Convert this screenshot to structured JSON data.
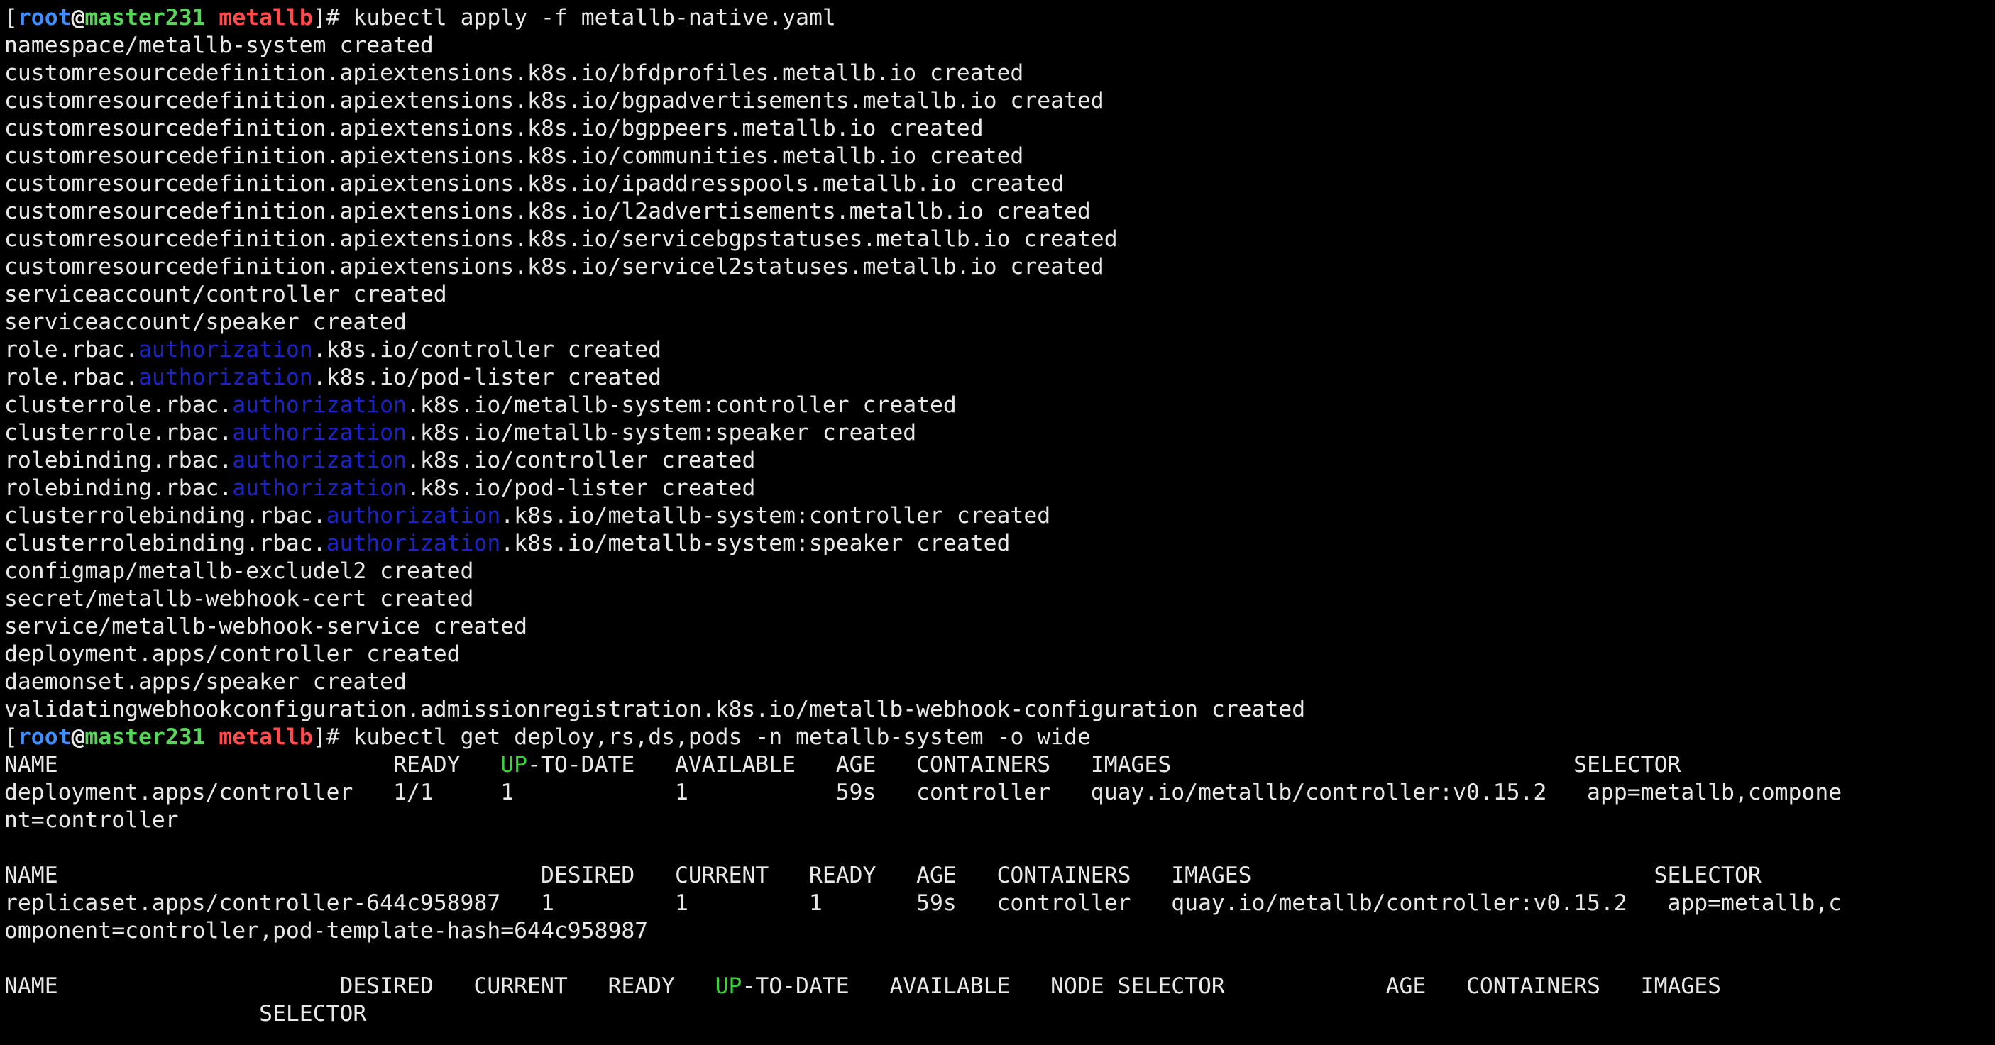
{
  "colors": {
    "background": "#000000",
    "foreground": "#e8e8e8",
    "prompt_user": "#3f8fff",
    "prompt_host": "#58d65a",
    "prompt_dir": "#ff4d4d",
    "highlight_blue": "#1a24c8",
    "highlight_green": "#3ad23a"
  },
  "lines": [
    [
      {
        "t": "[",
        "c": "b"
      },
      {
        "t": "root",
        "c": "user"
      },
      {
        "t": "@",
        "c": "at"
      },
      {
        "t": "master231",
        "c": "host"
      },
      {
        "t": " ",
        "c": "b"
      },
      {
        "t": "metallb",
        "c": "dir"
      },
      {
        "t": "]# kubectl apply -f metallb-native.yaml",
        "c": "b"
      }
    ],
    [
      {
        "t": "namespace/metallb-system created",
        "c": "b"
      }
    ],
    [
      {
        "t": "customresourcedefinition.apiextensions.k8s.io/bfdprofiles.metallb.io created",
        "c": "b"
      }
    ],
    [
      {
        "t": "customresourcedefinition.apiextensions.k8s.io/bgpadvertisements.metallb.io created",
        "c": "b"
      }
    ],
    [
      {
        "t": "customresourcedefinition.apiextensions.k8s.io/bgppeers.metallb.io created",
        "c": "b"
      }
    ],
    [
      {
        "t": "customresourcedefinition.apiextensions.k8s.io/communities.metallb.io created",
        "c": "b"
      }
    ],
    [
      {
        "t": "customresourcedefinition.apiextensions.k8s.io/ipaddresspools.metallb.io created",
        "c": "b"
      }
    ],
    [
      {
        "t": "customresourcedefinition.apiextensions.k8s.io/l2advertisements.metallb.io created",
        "c": "b"
      }
    ],
    [
      {
        "t": "customresourcedefinition.apiextensions.k8s.io/servicebgpstatuses.metallb.io created",
        "c": "b"
      }
    ],
    [
      {
        "t": "customresourcedefinition.apiextensions.k8s.io/servicel2statuses.metallb.io created",
        "c": "b"
      }
    ],
    [
      {
        "t": "serviceaccount/controller created",
        "c": "b"
      }
    ],
    [
      {
        "t": "serviceaccount/speaker created",
        "c": "b"
      }
    ],
    [
      {
        "t": "role.rbac.",
        "c": "b"
      },
      {
        "t": "authorization",
        "c": "blue"
      },
      {
        "t": ".k8s.io/controller created",
        "c": "b"
      }
    ],
    [
      {
        "t": "role.rbac.",
        "c": "b"
      },
      {
        "t": "authorization",
        "c": "blue"
      },
      {
        "t": ".k8s.io/pod-lister created",
        "c": "b"
      }
    ],
    [
      {
        "t": "clusterrole.rbac.",
        "c": "b"
      },
      {
        "t": "authorization",
        "c": "blue"
      },
      {
        "t": ".k8s.io/metallb-system:controller created",
        "c": "b"
      }
    ],
    [
      {
        "t": "clusterrole.rbac.",
        "c": "b"
      },
      {
        "t": "authorization",
        "c": "blue"
      },
      {
        "t": ".k8s.io/metallb-system:speaker created",
        "c": "b"
      }
    ],
    [
      {
        "t": "rolebinding.rbac.",
        "c": "b"
      },
      {
        "t": "authorization",
        "c": "blue"
      },
      {
        "t": ".k8s.io/controller created",
        "c": "b"
      }
    ],
    [
      {
        "t": "rolebinding.rbac.",
        "c": "b"
      },
      {
        "t": "authorization",
        "c": "blue"
      },
      {
        "t": ".k8s.io/pod-lister created",
        "c": "b"
      }
    ],
    [
      {
        "t": "clusterrolebinding.rbac.",
        "c": "b"
      },
      {
        "t": "authorization",
        "c": "blue"
      },
      {
        "t": ".k8s.io/metallb-system:controller created",
        "c": "b"
      }
    ],
    [
      {
        "t": "clusterrolebinding.rbac.",
        "c": "b"
      },
      {
        "t": "authorization",
        "c": "blue"
      },
      {
        "t": ".k8s.io/metallb-system:speaker created",
        "c": "b"
      }
    ],
    [
      {
        "t": "configmap/metallb-excludel2 created",
        "c": "b"
      }
    ],
    [
      {
        "t": "secret/metallb-webhook-cert created",
        "c": "b"
      }
    ],
    [
      {
        "t": "service/metallb-webhook-service created",
        "c": "b"
      }
    ],
    [
      {
        "t": "deployment.apps/controller created",
        "c": "b"
      }
    ],
    [
      {
        "t": "daemonset.apps/speaker created",
        "c": "b"
      }
    ],
    [
      {
        "t": "validatingwebhookconfiguration.admissionregistration.k8s.io/metallb-webhook-configuration created",
        "c": "b"
      }
    ],
    [
      {
        "t": "[",
        "c": "b"
      },
      {
        "t": "root",
        "c": "user"
      },
      {
        "t": "@",
        "c": "at"
      },
      {
        "t": "master231",
        "c": "host"
      },
      {
        "t": " ",
        "c": "b"
      },
      {
        "t": "metallb",
        "c": "dir"
      },
      {
        "t": "]# kubectl get deploy,rs,ds,pods -n metallb-system -o wide",
        "c": "b"
      }
    ],
    [
      {
        "t": "NAME                         READY   ",
        "c": "b"
      },
      {
        "t": "UP",
        "c": "green"
      },
      {
        "t": "-TO-DATE   AVAILABLE   AGE   CONTAINERS   IMAGES                              SELECTOR",
        "c": "b"
      }
    ],
    [
      {
        "t": "deployment.apps/controller   1/1     1            1           59s   controller   quay.io/metallb/controller:v0.15.2   app=metallb,compone",
        "c": "b"
      }
    ],
    [
      {
        "t": "nt=controller",
        "c": "b"
      }
    ],
    [
      {
        "t": "",
        "c": "b"
      }
    ],
    [
      {
        "t": "NAME                                    DESIRED   CURRENT   READY   AGE   CONTAINERS   IMAGES                              SELECTOR",
        "c": "b"
      }
    ],
    [
      {
        "t": "replicaset.apps/controller-644c958987   1         1         1       59s   controller   quay.io/metallb/controller:v0.15.2   app=metallb,c",
        "c": "b"
      }
    ],
    [
      {
        "t": "omponent=controller,pod-template-hash=644c958987",
        "c": "b"
      }
    ],
    [
      {
        "t": "",
        "c": "b"
      }
    ],
    [
      {
        "t": "NAME                     DESIRED   CURRENT   READY   ",
        "c": "b"
      },
      {
        "t": "UP",
        "c": "green"
      },
      {
        "t": "-TO-DATE   AVAILABLE   NODE SELECTOR            AGE   CONTAINERS   IMAGES",
        "c": "b"
      }
    ],
    [
      {
        "t": "                   SELECTOR",
        "c": "b"
      }
    ]
  ]
}
